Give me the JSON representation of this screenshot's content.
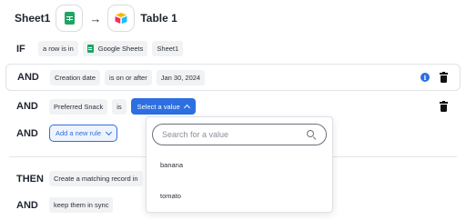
{
  "header": {
    "source_label": "Sheet1",
    "target_label": "Table 1",
    "source_icon": "google-sheets-icon",
    "target_icon": "airtable-icon"
  },
  "if_row": {
    "keyword": "IF",
    "chips": [
      "a row is in",
      "Google Sheets",
      "Sheet1"
    ]
  },
  "and_row_1": {
    "keyword": "AND",
    "field": "Creation date",
    "operator": "is on or after",
    "value": "Jan 30, 2024"
  },
  "and_row_2": {
    "keyword": "AND",
    "field": "Preferred Snack",
    "operator": "is",
    "select_label": "Select a value"
  },
  "and_row_3": {
    "keyword": "AND",
    "add_rule_label": "Add a new rule"
  },
  "then_row": {
    "keyword": "THEN",
    "action": "Create a matching record in"
  },
  "and_row_4": {
    "keyword": "AND",
    "option": "keep them in sync"
  },
  "dropdown": {
    "search_placeholder": "Search for a value",
    "options": [
      "banana",
      "tomato"
    ]
  },
  "colors": {
    "accent": "#2d6fe0",
    "sheets_green": "#1fa463",
    "chip_bg": "#f1f2f4"
  }
}
